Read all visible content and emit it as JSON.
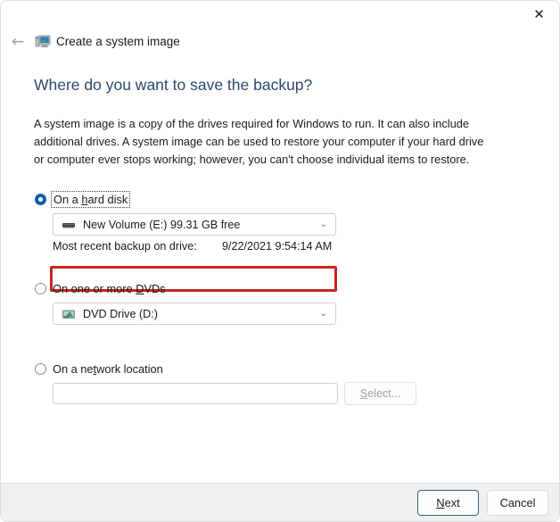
{
  "window": {
    "app_title": "Create a system image",
    "app_icon": "computer-monitor-icon",
    "close_icon": "✕",
    "back_icon": "←"
  },
  "content": {
    "heading": "Where do you want to save the backup?",
    "intro": "A system image is a copy of the drives required for Windows to run. It can also include additional drives. A system image can be used to restore your computer if your hard drive or computer ever stops working; however, you can't choose individual items to restore."
  },
  "options": {
    "hard_disk": {
      "label_pre": "On a ",
      "label_accel": "h",
      "label_post": "ard disk",
      "selected": true,
      "combo_value": "New Volume (E:)  99.31 GB free",
      "combo_icon": "hard-drive-icon",
      "backup_label": "Most recent backup on drive:",
      "backup_value": "9/22/2021 9:54:14 AM"
    },
    "dvd": {
      "label_pre": "On one or more ",
      "label_accel": "D",
      "label_post": "VDs",
      "selected": false,
      "combo_value": "DVD Drive (D:)",
      "combo_icon": "dvd-drive-icon"
    },
    "network": {
      "label_pre": "On a ne",
      "label_accel": "t",
      "label_post": "work location",
      "selected": false,
      "input_value": "",
      "input_placeholder": "",
      "select_pre": "",
      "select_accel": "S",
      "select_post": "elect...",
      "select_disabled": true
    }
  },
  "footer": {
    "next_pre": "",
    "next_accel": "N",
    "next_post": "ext",
    "cancel_label": "Cancel"
  },
  "colors": {
    "heading": "#30486b",
    "annotation_red": "#c9241f",
    "radio_selected": "#0f5ca8",
    "footer_bg": "#f0f0f0"
  },
  "dropdown_arrow": "⌄"
}
